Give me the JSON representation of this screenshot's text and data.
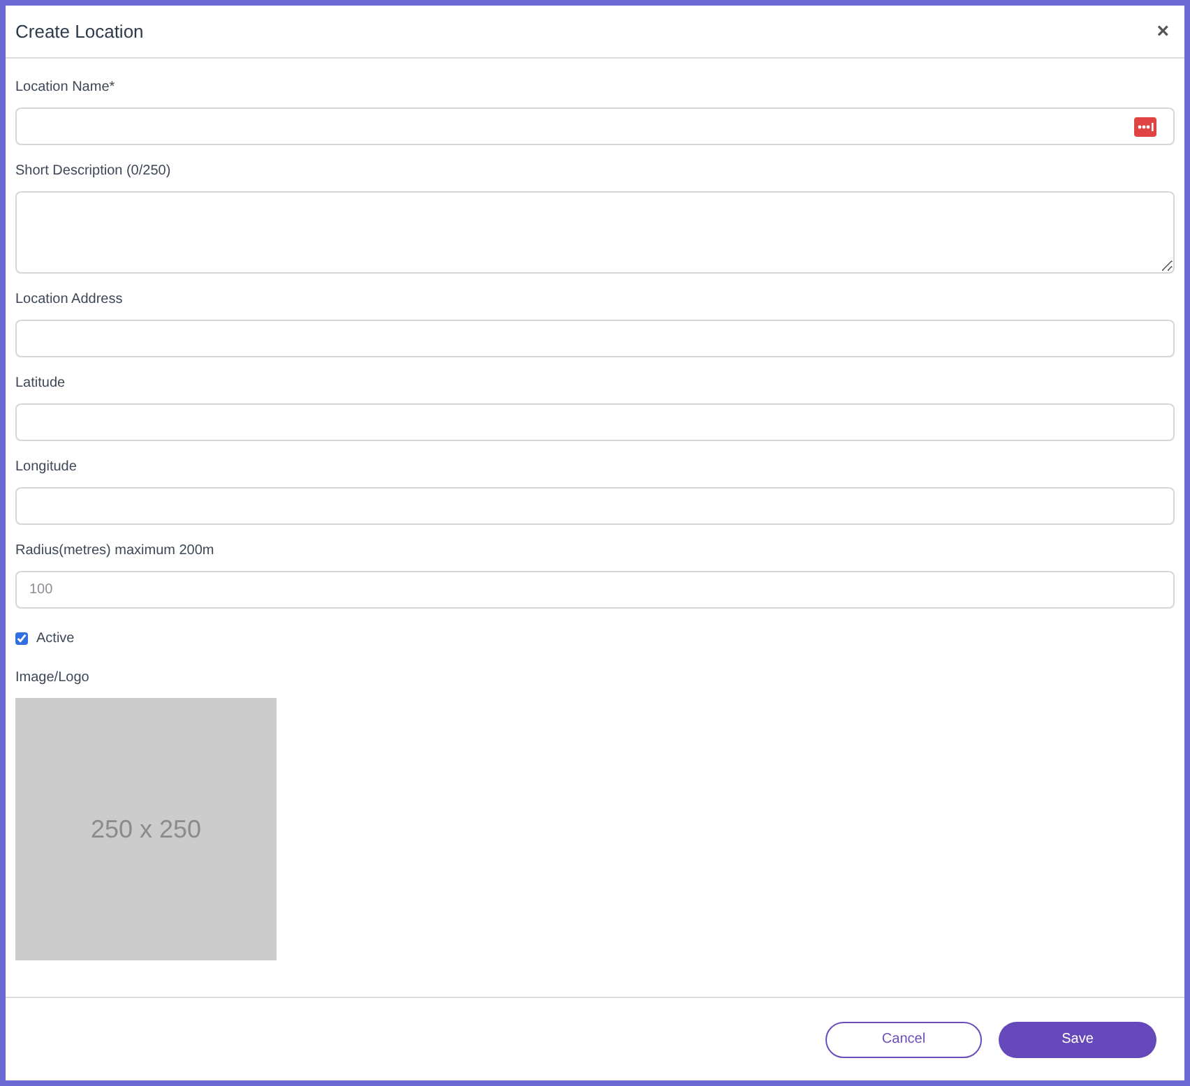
{
  "dialog": {
    "title": "Create Location",
    "close": "×"
  },
  "fields": [
    {
      "kind": "text",
      "label": "Location Name*",
      "password_manager_badge": true
    },
    {
      "kind": "textarea",
      "label": "Short Description (0/250)"
    },
    {
      "kind": "text",
      "label": "Location Address"
    },
    {
      "kind": "text",
      "label": "Latitude"
    },
    {
      "kind": "text",
      "label": "Longitude"
    },
    {
      "kind": "text",
      "label": "Radius(metres) maximum 200m",
      "placeholder": "100"
    }
  ],
  "active": {
    "label": "Active",
    "checked": true
  },
  "image": {
    "label": "Image/Logo",
    "placeholder_text": "250 x 250"
  },
  "buttons": [
    {
      "kind": "secondary",
      "label": "Cancel"
    },
    {
      "kind": "primary",
      "label": "Save"
    }
  ]
}
